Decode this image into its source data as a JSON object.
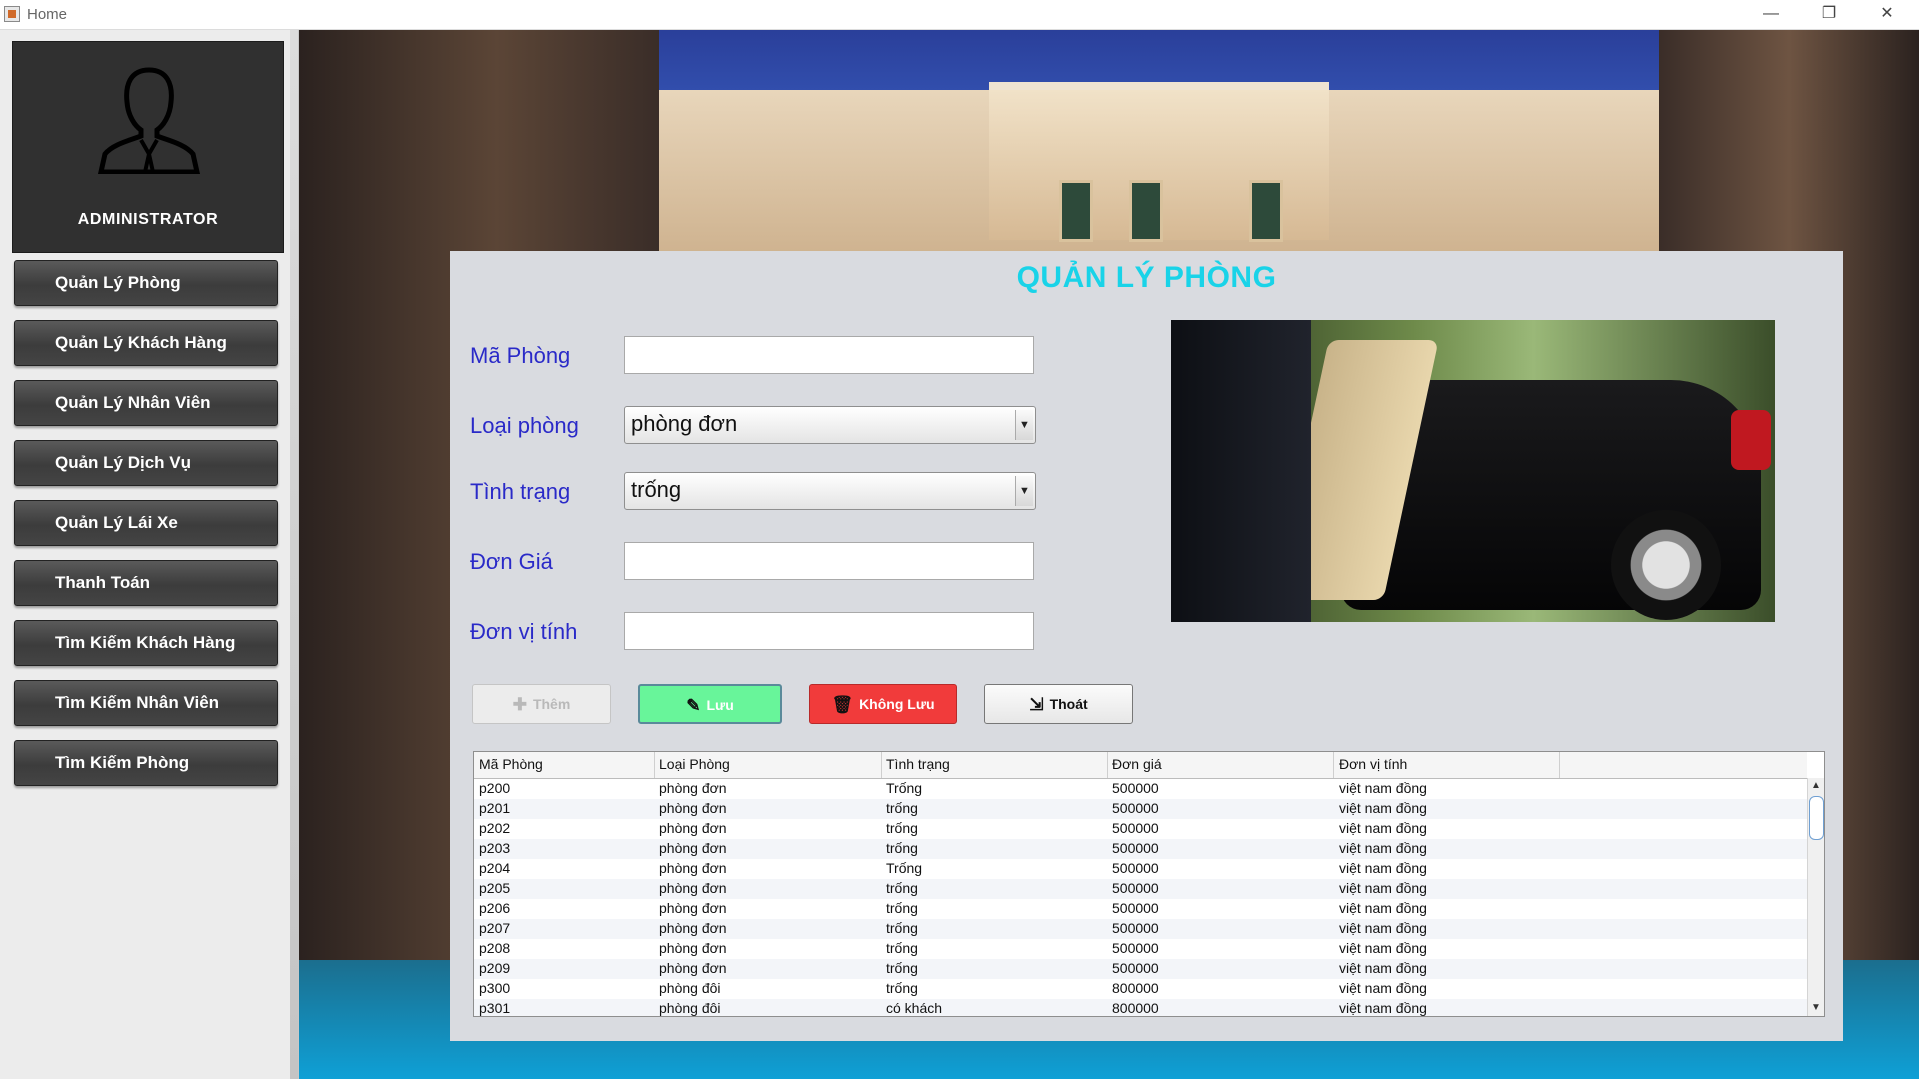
{
  "window": {
    "title": "Home",
    "minimize": "—",
    "restore": "❐",
    "close": "✕"
  },
  "sidebar": {
    "admin_label": "ADMINISTRATOR",
    "items": [
      {
        "label": "Quản Lý Phòng"
      },
      {
        "label": "Quản Lý Khách Hàng"
      },
      {
        "label": "Quản Lý Nhân Viên"
      },
      {
        "label": "Quản Lý Dịch Vụ"
      },
      {
        "label": "Quản Lý Lái Xe"
      },
      {
        "label": "Thanh Toán"
      },
      {
        "label": "Tìm Kiếm Khách Hàng"
      },
      {
        "label": "Tìm Kiếm Nhân Viên"
      },
      {
        "label": "Tìm Kiếm Phòng"
      }
    ]
  },
  "form": {
    "title": "QUẢN LÝ PHÒNG",
    "ma_phong_label": "Mã Phòng",
    "ma_phong_value": "",
    "loai_phong_label": "Loại phòng",
    "loai_phong_value": "phòng đơn",
    "tinh_trang_label": "Tình trạng",
    "tinh_trang_value": "trống",
    "don_gia_label": "Đơn Giá",
    "don_gia_value": "",
    "don_vi_tinh_label": "Đơn vị tính",
    "don_vi_tinh_value": ""
  },
  "buttons": {
    "them": "Thêm",
    "luu": "Lưu",
    "khong_luu": "Không Lưu",
    "thoat": "Thoát"
  },
  "table": {
    "columns": [
      "Mã Phòng",
      "Loại Phòng",
      "Tình trạng",
      "Đơn giá",
      "Đơn vị tính"
    ],
    "rows": [
      [
        "p200",
        "phòng đơn",
        "Trống",
        "500000",
        "việt nam đồng"
      ],
      [
        "p201",
        "phòng đơn",
        "trống",
        "500000",
        "việt nam đồng"
      ],
      [
        "p202",
        "phòng đơn",
        "trống",
        "500000",
        "việt nam đồng"
      ],
      [
        "p203",
        "phòng đơn",
        "trống",
        "500000",
        "việt nam đồng"
      ],
      [
        "p204",
        "phòng đơn",
        "Trống",
        "500000",
        "việt nam đồng"
      ],
      [
        "p205",
        "phòng đơn",
        "trống",
        "500000",
        "việt nam đồng"
      ],
      [
        "p206",
        "phòng đơn",
        "trống",
        "500000",
        "việt nam đồng"
      ],
      [
        "p207",
        "phòng đơn",
        "trống",
        "500000",
        "việt nam đồng"
      ],
      [
        "p208",
        "phòng đơn",
        "trống",
        "500000",
        "việt nam đồng"
      ],
      [
        "p209",
        "phòng đơn",
        "trống",
        "500000",
        "việt nam đồng"
      ],
      [
        "p300",
        "phòng đôi",
        "trống",
        "800000",
        "việt nam đồng"
      ],
      [
        "p301",
        "phòng đôi",
        "có khách",
        "800000",
        "việt nam đồng"
      ]
    ]
  },
  "colors": {
    "title": "#19d3e8",
    "label": "#2a2ac8",
    "save_button": "#68f59a",
    "discard_button": "#f13b3b",
    "sidebar_button": "#444444"
  }
}
